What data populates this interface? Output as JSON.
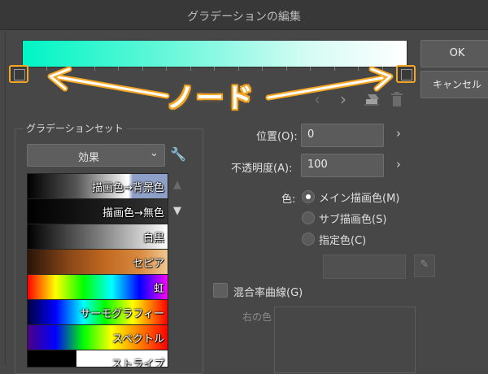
{
  "window": {
    "title": "グラデーションの編集"
  },
  "buttons": {
    "ok": "OK",
    "cancel": "キャンセル"
  },
  "gradient": {
    "start_color": "#00f5c4",
    "end_color": "#ffffff"
  },
  "annotation": {
    "label": "ノード",
    "color": "#f5a623"
  },
  "toolbar_icons": [
    "chevron-left-icon",
    "chevron-right-icon",
    "eraser-icon",
    "trash-icon"
  ],
  "gradient_set": {
    "label": "グラデーションセット",
    "selected": "効果",
    "items": [
      {
        "label": "描画色→背景色",
        "style": "linear-gradient(to right,#000 0%,#555 35%,#fff 72%,#fff 72%,#8fa0c8 75%,#8fa0c8 100%)"
      },
      {
        "label": "描画色→無色",
        "style": "linear-gradient(to right,#000 0%,#1e1e1e 60%,#353535 100%)"
      },
      {
        "label": "白黒",
        "style": "linear-gradient(to right,#000 0%,#7a7a7a 50%,#ffffff 100%)"
      },
      {
        "label": "セピア",
        "style": "linear-gradient(to right,#2a1408 0%,#8a4818 30%,#c06820 55%,#d88a40 80%,#f0c890 100%)"
      },
      {
        "label": "虹",
        "style": "linear-gradient(to right,#ff0000 0%,#ffff00 20%,#00ff00 40%,#00ffff 60%,#0000ff 80%,#ff00ff 100%)"
      },
      {
        "label": "サーモグラフィー",
        "style": "linear-gradient(to right,#000040 0%,#0000ff 20%,#00ffff 40%,#00ff00 55%,#ffff00 75%,#ff0000 100%)"
      },
      {
        "label": "スペクトル",
        "style": "linear-gradient(to right,#4b0082 0%,#0000ff 20%,#00ff00 40%,#ffff00 60%,#ff8000 80%,#ff0000 100%)"
      },
      {
        "label": "ストライプ",
        "style": "linear-gradient(to right,#000 0%,#000 35%,#fff 35%,#fff 100%)"
      }
    ]
  },
  "properties": {
    "position_label": "位置(O):",
    "position_value": "0",
    "opacity_label": "不透明度(A):",
    "opacity_value": "100",
    "color_label": "色:",
    "color_options": [
      "メイン描画色(M)",
      "サブ描画色(S)",
      "指定色(C)"
    ],
    "color_selected_index": 0,
    "blend_curve_label": "混合率曲線(G)",
    "curve_side_label": "右の色"
  }
}
